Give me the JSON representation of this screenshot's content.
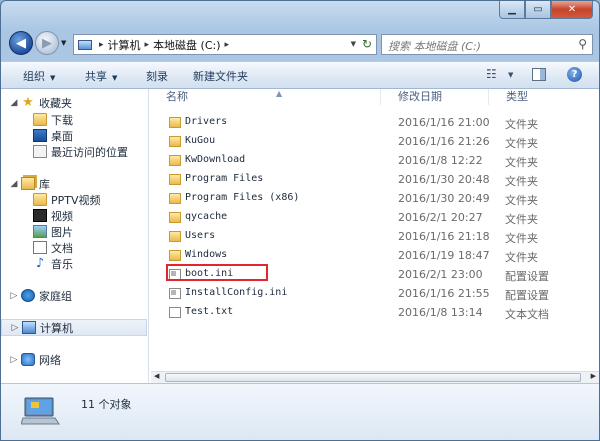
{
  "window": {
    "minimize_icon": "minimize-icon",
    "maximize_icon": "maximize-icon",
    "close_icon": "close-icon"
  },
  "address": {
    "crumbs": [
      "计算机",
      "本地磁盘 (C:)"
    ]
  },
  "search": {
    "placeholder": "搜索 本地磁盘 (C:)"
  },
  "toolbar": {
    "organize": "组织",
    "share": "共享",
    "burn": "刻录",
    "new_folder": "新建文件夹"
  },
  "nav": {
    "favorites": "收藏夹",
    "downloads": "下载",
    "desktop": "桌面",
    "recent": "最近访问的位置",
    "libraries": "库",
    "pptv": "PPTV视频",
    "videos": "视频",
    "pictures": "图片",
    "documents": "文档",
    "music": "音乐",
    "homegroup": "家庭组",
    "computer": "计算机",
    "network": "网络"
  },
  "columns": {
    "name": "名称",
    "modified": "修改日期",
    "type": "类型"
  },
  "files": [
    {
      "name": "Drivers",
      "date": "2016/1/16 21:00",
      "type": "文件夹",
      "kind": "folder"
    },
    {
      "name": "KuGou",
      "date": "2016/1/16 21:26",
      "type": "文件夹",
      "kind": "folder"
    },
    {
      "name": "KwDownload",
      "date": "2016/1/8 12:22",
      "type": "文件夹",
      "kind": "folder"
    },
    {
      "name": "Program Files",
      "date": "2016/1/30 20:48",
      "type": "文件夹",
      "kind": "folder"
    },
    {
      "name": "Program Files (x86)",
      "date": "2016/1/30 20:49",
      "type": "文件夹",
      "kind": "folder"
    },
    {
      "name": "qycache",
      "date": "2016/2/1 20:27",
      "type": "文件夹",
      "kind": "folder"
    },
    {
      "name": "Users",
      "date": "2016/1/16 21:18",
      "type": "文件夹",
      "kind": "folder"
    },
    {
      "name": "Windows",
      "date": "2016/1/19 18:47",
      "type": "文件夹",
      "kind": "folder"
    },
    {
      "name": "boot.ini",
      "date": "2016/2/1 23:00",
      "type": "配置设置",
      "kind": "ini"
    },
    {
      "name": "InstallConfig.ini",
      "date": "2016/1/16 21:55",
      "type": "配置设置",
      "kind": "ini"
    },
    {
      "name": "Test.txt",
      "date": "2016/1/8 13:14",
      "type": "文本文档",
      "kind": "txt"
    }
  ],
  "status": {
    "count": "11 个对象"
  },
  "highlight_color": "#e0262f"
}
